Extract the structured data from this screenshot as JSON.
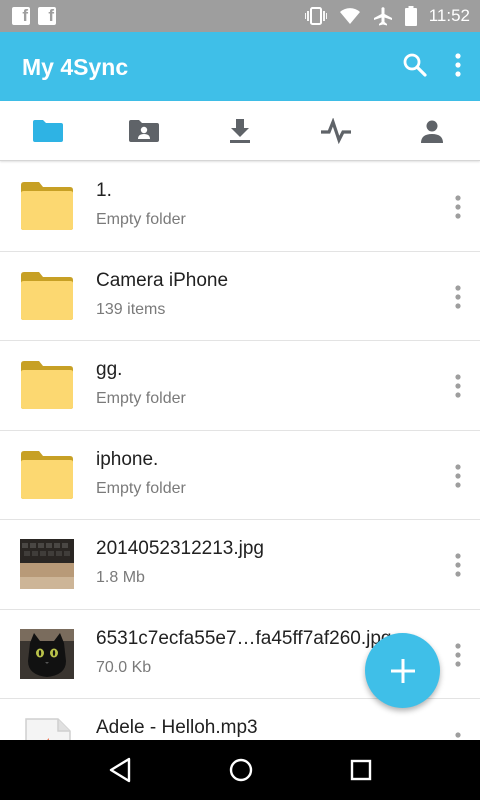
{
  "status_bar": {
    "notifications": [
      "facebook-icon",
      "facebook-icon"
    ],
    "icons": [
      "vibrate-icon",
      "wifi-icon",
      "airplane-icon",
      "battery-icon"
    ],
    "time": "11:52",
    "fb_glyph": "f"
  },
  "app_bar": {
    "title": "My 4Sync",
    "actions": [
      "search-icon",
      "overflow-menu-icon"
    ],
    "color": "#3fbfe8"
  },
  "tabs": [
    {
      "icon": "folder-icon",
      "selected": true
    },
    {
      "icon": "shared-folder-icon",
      "selected": false
    },
    {
      "icon": "download-icon",
      "selected": false
    },
    {
      "icon": "activity-icon",
      "selected": false
    },
    {
      "icon": "account-icon",
      "selected": false
    }
  ],
  "files": [
    {
      "name": "1.",
      "meta": "Empty folder",
      "type": "folder"
    },
    {
      "name": "Camera iPhone",
      "meta": "139 items",
      "type": "folder"
    },
    {
      "name": "gg.",
      "meta": "Empty folder",
      "type": "folder"
    },
    {
      "name": "iphone.",
      "meta": "Empty folder",
      "type": "folder"
    },
    {
      "name": "2014052312213.jpg",
      "meta": "1.8 Mb",
      "type": "image-keyboard"
    },
    {
      "name": "6531c7ecfa55e7…fa45ff7af260.jpg",
      "meta": "70.0 Kb",
      "type": "image-cat"
    },
    {
      "name": "Adele - Helloh.mp3",
      "meta": "",
      "type": "audio"
    }
  ],
  "fab": {
    "icon": "add-icon"
  },
  "nav_bar": {
    "icons": [
      "back-icon",
      "home-icon",
      "recents-icon"
    ]
  }
}
